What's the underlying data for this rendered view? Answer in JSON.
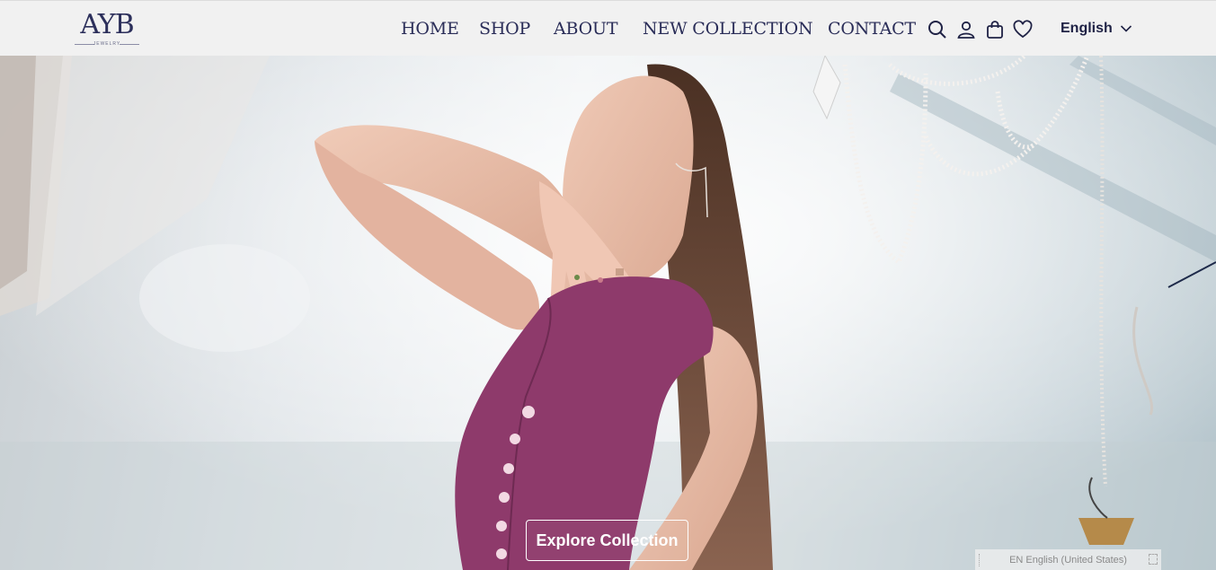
{
  "brand": {
    "logo_text": "AYB",
    "logo_sub": "JEWELRY"
  },
  "nav": {
    "items": [
      {
        "label": "HOME"
      },
      {
        "label": "SHOP"
      },
      {
        "label": "ABOUT"
      },
      {
        "label": "NEW COLLECTION"
      },
      {
        "label": "CONTACT"
      }
    ]
  },
  "header_icons": [
    "search-icon",
    "user-icon",
    "shopping-bag-icon",
    "heart-icon"
  ],
  "language": {
    "selected": "English"
  },
  "hero": {
    "cta_label": "Explore Collection"
  },
  "language_pill": {
    "text": "EN English (United States)"
  },
  "colors": {
    "nav_text": "#2a2d58",
    "dress": "#8e3a6b",
    "cta_border": "#ffffff"
  }
}
